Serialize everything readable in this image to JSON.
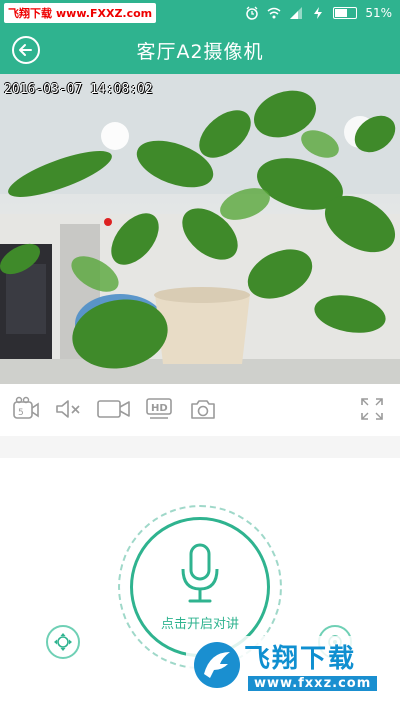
{
  "status_bar": {
    "watermark_name": "飞翔下载",
    "watermark_url": "www.FXXZ.com",
    "battery": "51%",
    "battery_level": 0.51,
    "icons": [
      "alarm-icon",
      "wifi-icon",
      "signal-icon",
      "charging-icon",
      "battery-icon"
    ]
  },
  "header": {
    "title": "客厅A2摄像机",
    "back_icon": "back-arrow-icon"
  },
  "video": {
    "timestamp": "2016-03-07 14:08:02"
  },
  "toolbar": {
    "buttons": [
      {
        "icon": "switch-camera-icon"
      },
      {
        "icon": "mute-icon"
      },
      {
        "icon": "record-video-icon"
      },
      {
        "icon": "hd-icon",
        "label": "HD"
      },
      {
        "icon": "snapshot-camera-icon"
      },
      {
        "icon": "fullscreen-icon"
      }
    ]
  },
  "talk": {
    "label": "点击开启对讲",
    "icon": "microphone-icon"
  },
  "side_buttons": [
    {
      "icon": "ptz-direction-icon"
    },
    {
      "icon": "preset-icon"
    }
  ],
  "watermark": {
    "brand_cn": "飞翔下载",
    "brand_url": "www.fxxz.com"
  },
  "colors": {
    "accent": "#2fb38f",
    "accent_light": "#9fd8c9",
    "icon_gray": "#9a9a9a"
  }
}
